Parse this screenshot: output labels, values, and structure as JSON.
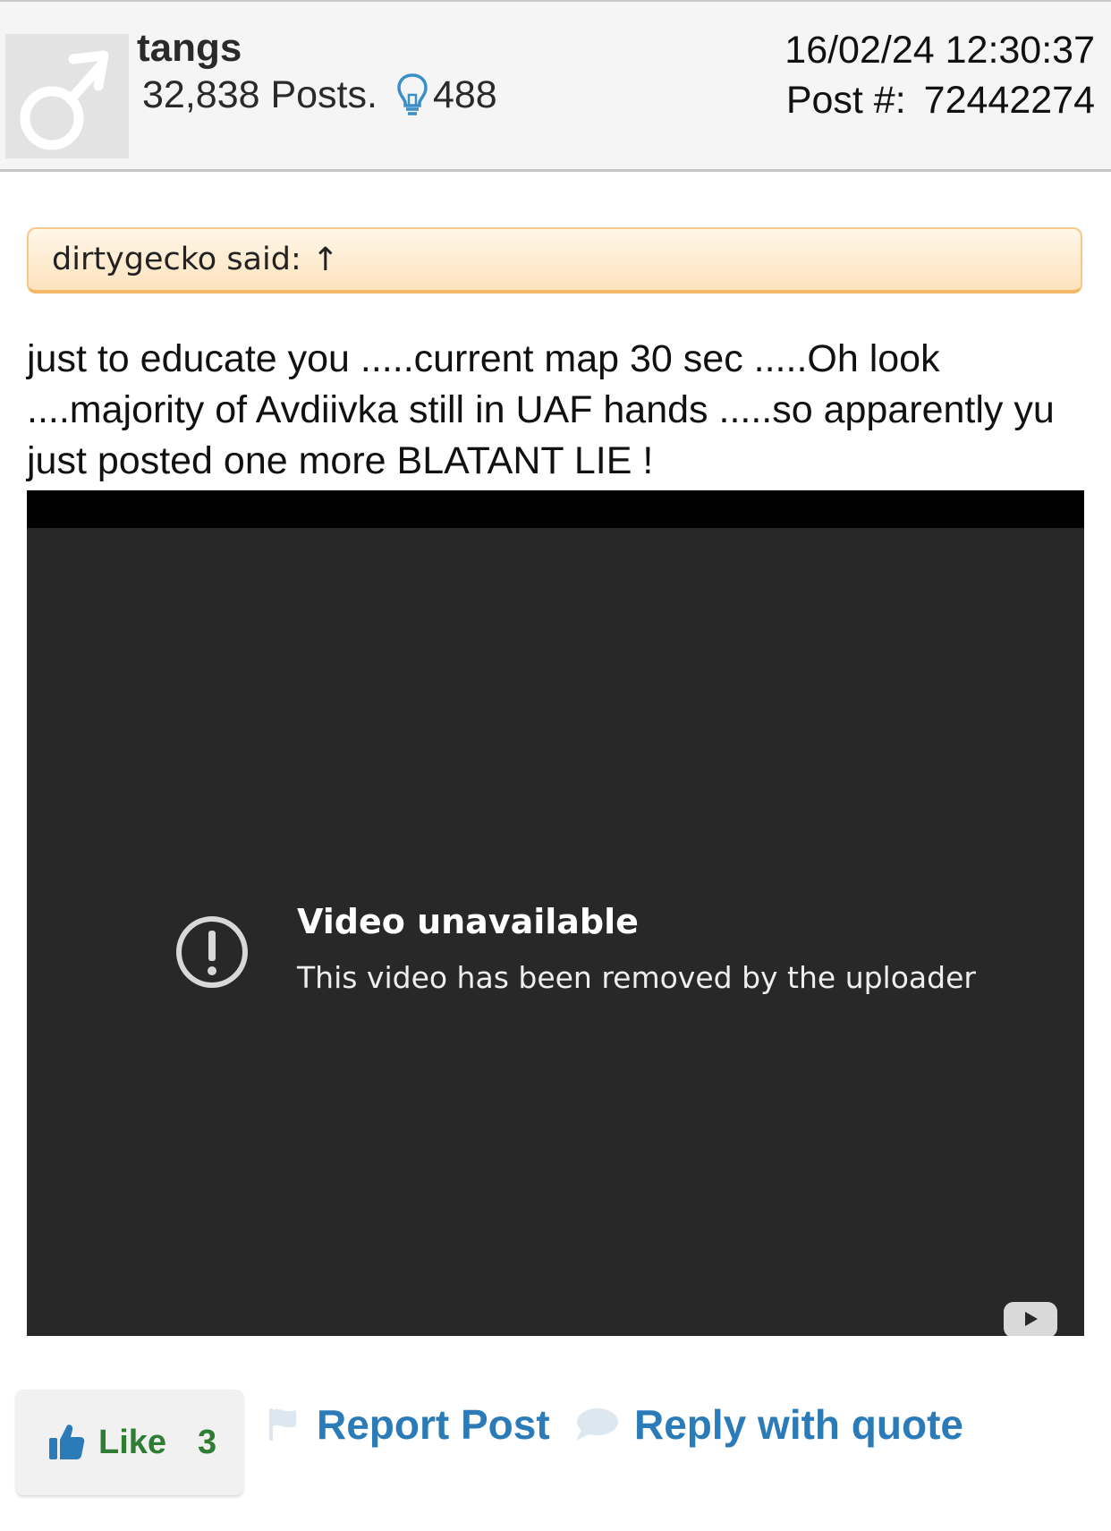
{
  "post": {
    "username": "tangs",
    "posts_count": "32,838 Posts.",
    "reputation": "488",
    "date": "16/02/24  12:30:37",
    "post_number_label": "Post #:",
    "post_number": "72442274",
    "avatar_icon": "male-symbol-icon",
    "reputation_icon": "lightbulb-icon"
  },
  "quote": {
    "text": "dirtygecko said:",
    "arrow": "↑"
  },
  "body": {
    "text": "just to educate you .....current map 30 sec .....Oh look ....majority of Avdiivka still in UAF hands .....so apparently yu just posted one more BLATANT LIE !"
  },
  "video": {
    "title": "Video unavailable",
    "message": "This video has been removed by the uploader",
    "icon": "warning-icon",
    "logo": "youtube-icon"
  },
  "actions": {
    "like_label": "Like",
    "like_count": "3",
    "report_label": "Report Post",
    "reply_label": "Reply with quote",
    "like_color": "#2e7d32",
    "link_color": "#2b7bb9"
  }
}
